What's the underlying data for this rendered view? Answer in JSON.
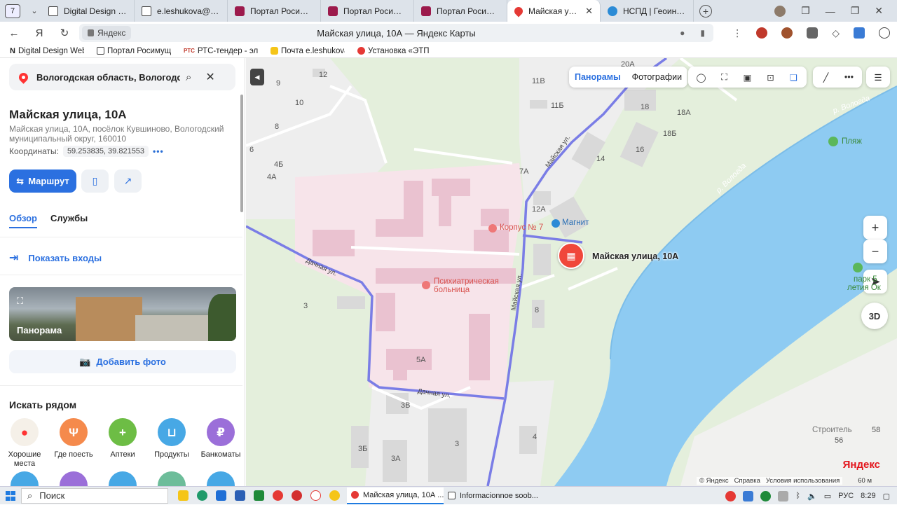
{
  "browser": {
    "tab_count": "7",
    "tabs": [
      {
        "label": "Digital Design Web",
        "icon": "doc"
      },
      {
        "label": "e.leshukova@rosim",
        "icon": "doc"
      },
      {
        "label": "Портал Росимущес",
        "icon": "rosim"
      },
      {
        "label": "Портал Росимущес",
        "icon": "rosim"
      },
      {
        "label": "Портал Росимущес",
        "icon": "rosim"
      },
      {
        "label": "Майская улица, 1",
        "icon": "ymap",
        "active": true
      },
      {
        "label": "НСПД | Геоинформ",
        "icon": "nspd"
      }
    ],
    "address": {
      "site": "Яндекс",
      "page_title": "Майская улица, 10А — Яндекс Карты"
    },
    "bookmarks": [
      {
        "label": "Digital Design Web"
      },
      {
        "label": "Портал Росимущес"
      },
      {
        "label": "РТС-тендер - элек"
      },
      {
        "label": "Почта e.leshukova"
      },
      {
        "label": "Установка «ЭТП и"
      }
    ]
  },
  "panel": {
    "search_value": "Вологодская область, Вологодский р",
    "place_title": "Майская улица, 10А",
    "place_address": "Майская улица, 10А, посёлок Кувшиново, Вологодский муниципальный округ, 160010",
    "coords_label": "Координаты:",
    "coords_value": "59.253835, 39.821553",
    "route_label": "Маршрут",
    "tabs": [
      "Обзор",
      "Службы"
    ],
    "entrances_label": "Показать входы",
    "panorama_label": "Панорама",
    "add_photo_label": "Добавить фото",
    "nearby_title": "Искать рядом",
    "nearby": [
      {
        "label": "Хорошие места",
        "color": "#f5a623"
      },
      {
        "label": "Где поесть",
        "color": "#f58a4c"
      },
      {
        "label": "Аптеки",
        "color": "#6dbd45"
      },
      {
        "label": "Продукты",
        "color": "#47a8e5"
      },
      {
        "label": "Банкоматы",
        "color": "#9b6fd9"
      }
    ]
  },
  "map": {
    "layers": [
      "Панорамы",
      "Фотографии"
    ],
    "marker_label": "Майская улица, 10А",
    "three_d_label": "3D",
    "poi": {
      "korpus": "Корпус № 7",
      "magnit": "Магнит",
      "hospital_line1": "Психиатрическая",
      "hospital_line2": "больница",
      "beach": "Пляж",
      "park_line1": "парк 5",
      "park_line2": "летия Ок",
      "stroitel": "Строитель"
    },
    "streets": {
      "mayskaya": "Майская ул.",
      "dachnaya": "Дачная ул.",
      "river": "р. Вологда"
    },
    "house_numbers": [
      "12",
      "9",
      "10",
      "8",
      "6",
      "4Б",
      "4А",
      "11В",
      "11Б",
      "20А",
      "18",
      "18А",
      "18Б",
      "16",
      "14",
      "7А",
      "12А",
      "8",
      "3",
      "5А",
      "3В",
      "3Б",
      "3А",
      "3",
      "4",
      "56",
      "58"
    ],
    "brand": "Яндекс",
    "footer_links": [
      "© Яндекс",
      "Справка",
      "Условия использования"
    ],
    "scale": "60 м"
  },
  "taskbar": {
    "search_label": "Поиск",
    "apps": [
      {
        "label": "Майская улица, 10А ...",
        "active": true
      },
      {
        "label": "Informacionnoe soob...",
        "active": false
      }
    ],
    "lang": "РУС",
    "time": "8:29"
  }
}
